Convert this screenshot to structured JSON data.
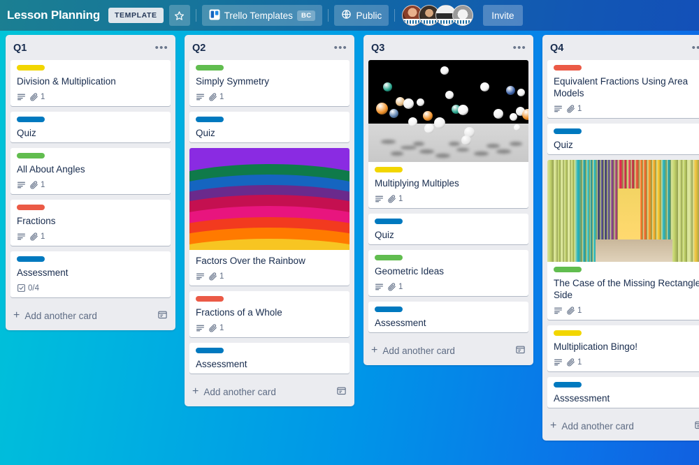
{
  "header": {
    "board_title": "Lesson Planning",
    "template_badge": "TEMPLATE",
    "star_icon": "star-icon",
    "workspace_name": "Trello Templates",
    "workspace_initials": "BC",
    "visibility_label": "Public",
    "visibility_icon": "globe-icon",
    "invite_label": "Invite",
    "members": [
      {
        "name": "member-1",
        "color": "#8a5a44"
      },
      {
        "name": "member-2",
        "color": "#4a3b2e"
      },
      {
        "name": "member-3",
        "color": "#3c3c3c"
      },
      {
        "name": "member-4",
        "color": "#6d6d6d"
      }
    ]
  },
  "board": {
    "background_start": "#00c5d7",
    "background_end": "#1160e0",
    "add_card_label": "Add another card",
    "list_menu_icon": "ellipsis-icon",
    "add_card_icon": "template-card-icon",
    "label_colors": {
      "yellow": "#f2d600",
      "blue": "#0079bf",
      "green": "#61bd4f",
      "red": "#eb5a46"
    },
    "lists": [
      {
        "title": "Q1",
        "cards": [
          {
            "title": "Division & Multiplication",
            "label": "yellow",
            "attachments": "1",
            "has_description": true
          },
          {
            "title": "Quiz",
            "label": "blue"
          },
          {
            "title": "All About Angles",
            "label": "green",
            "attachments": "1",
            "has_description": true
          },
          {
            "title": "Fractions",
            "label": "red",
            "attachments": "1",
            "has_description": true
          },
          {
            "title": "Assessment",
            "label": "blue",
            "checklist": "0/4"
          }
        ]
      },
      {
        "title": "Q2",
        "cards": [
          {
            "title": "Simply Symmetry",
            "label": "green",
            "attachments": "1",
            "has_description": true
          },
          {
            "title": "Quiz",
            "label": "blue"
          },
          {
            "title": "Factors Over the Rainbow",
            "cover": "rainbow-arcs",
            "attachments": "1",
            "has_description": true
          },
          {
            "title": "Fractions of a Whole",
            "label": "red",
            "attachments": "1",
            "has_description": true
          },
          {
            "title": "Assessment",
            "label": "blue"
          }
        ]
      },
      {
        "title": "Q3",
        "cards": [
          {
            "title": "Multiplying Multiples",
            "cover": "bouncing-balls",
            "label": "yellow",
            "attachments": "1",
            "has_description": true
          },
          {
            "title": "Quiz",
            "label": "blue"
          },
          {
            "title": "Geometric Ideas",
            "label": "green",
            "attachments": "1",
            "has_description": true
          },
          {
            "title": "Assessment",
            "label": "blue"
          }
        ]
      },
      {
        "title": "Q4",
        "cards": [
          {
            "title": "Equivalent Fractions Using Area Models",
            "label": "red",
            "attachments": "1",
            "has_description": true
          },
          {
            "title": "Quiz",
            "label": "blue"
          },
          {
            "title": "The Case of the Missing Rectangle Side",
            "cover": "rainbow-corridor",
            "label": "green",
            "attachments": "1",
            "has_description": true
          },
          {
            "title": "Multiplication Bingo!",
            "label": "yellow",
            "attachments": "1",
            "has_description": true
          },
          {
            "title": "Asssessment",
            "label": "blue"
          }
        ]
      }
    ]
  }
}
